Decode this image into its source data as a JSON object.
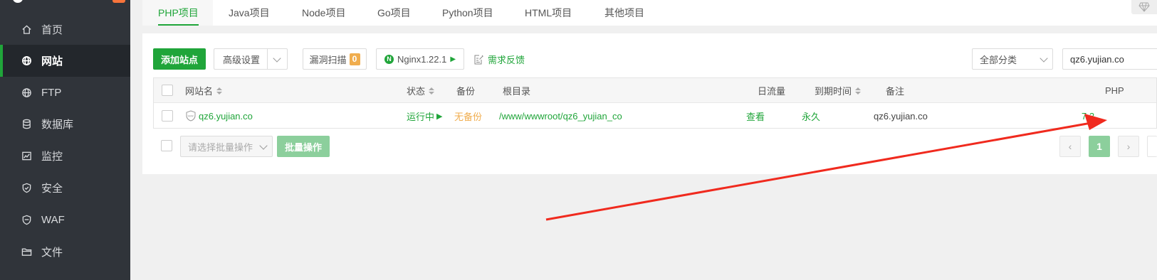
{
  "sidebar": {
    "items": [
      {
        "label": "首页",
        "icon": "home-icon"
      },
      {
        "label": "网站",
        "icon": "globe-icon",
        "active": true
      },
      {
        "label": "FTP",
        "icon": "ftp-globe-icon"
      },
      {
        "label": "数据库",
        "icon": "database-icon"
      },
      {
        "label": "监控",
        "icon": "monitor-icon"
      },
      {
        "label": "安全",
        "icon": "shield-icon"
      },
      {
        "label": "WAF",
        "icon": "waf-shield-icon"
      },
      {
        "label": "文件",
        "icon": "folder-icon"
      }
    ]
  },
  "tabs": [
    {
      "label": "PHP项目",
      "active": true
    },
    {
      "label": "Java项目"
    },
    {
      "label": "Node项目"
    },
    {
      "label": "Go项目"
    },
    {
      "label": "Python项目"
    },
    {
      "label": "HTML项目"
    },
    {
      "label": "其他项目"
    }
  ],
  "toolbar": {
    "add_site": "添加站点",
    "advanced": "高级设置",
    "vuln_scan": "漏洞扫描",
    "vuln_count": "0",
    "nginx": "Nginx1.22.1",
    "feedback": "需求反馈",
    "category": "全部分类",
    "search_value": "qz6.yujian.co"
  },
  "table": {
    "headers": {
      "name": "网站名",
      "status": "状态",
      "backup": "备份",
      "root": "根目录",
      "traffic": "日流量",
      "expire": "到期时间",
      "note": "备注",
      "php": "PHP"
    },
    "rows": [
      {
        "waf": "WAF",
        "name": "qz6.yujian.co",
        "status": "运行中",
        "backup": "无备份",
        "root": "/www/wwwroot/qz6_yujian_co",
        "traffic": "查看",
        "expire": "永久",
        "note": "qz6.yujian.co",
        "php": "7.2"
      }
    ]
  },
  "batch": {
    "select_placeholder": "请选择批量操作",
    "button": "批量操作"
  },
  "pager": {
    "prev": "‹",
    "current": "1",
    "next": "›"
  },
  "colors": {
    "accent": "#20a53a",
    "sidebar_bg": "#30343a",
    "annotation_arrow": "#f02a1e"
  }
}
